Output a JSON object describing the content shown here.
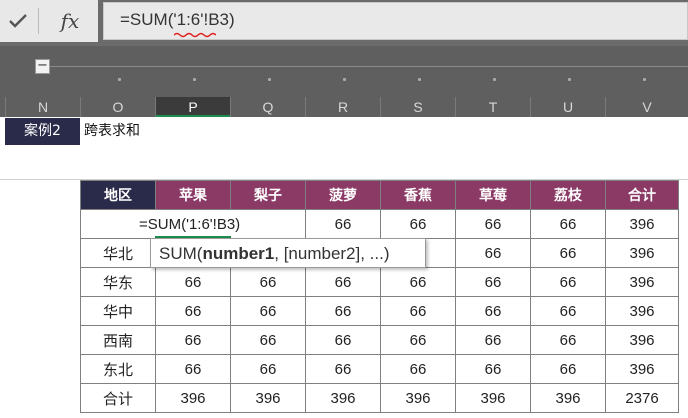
{
  "formula_bar": {
    "cancel_icon": "check-icon",
    "fx_label": "fx",
    "formula_text": "=SUM('1:6'!B3)"
  },
  "ribbon": {
    "collapse_label": "−"
  },
  "columns": [
    "N",
    "O",
    "P",
    "Q",
    "R",
    "S",
    "T",
    "U",
    "V"
  ],
  "active_column": "P",
  "sheet": {
    "case_label": "案例2",
    "case_title": "跨表求和"
  },
  "table": {
    "headers": [
      "地区",
      "苹果",
      "梨子",
      "菠萝",
      "香蕉",
      "草莓",
      "荔枝",
      "合计"
    ],
    "edit_cell_text": "=SUM('1:6'!B3)",
    "first_row_rest": [
      "66",
      "66",
      "66",
      "66",
      "396"
    ],
    "rows": [
      {
        "region": "华北",
        "values": [
          "",
          "",
          "",
          "66",
          "66",
          "66",
          "396"
        ]
      },
      {
        "region": "华东",
        "values": [
          "66",
          "66",
          "66",
          "66",
          "66",
          "66",
          "396"
        ]
      },
      {
        "region": "华中",
        "values": [
          "66",
          "66",
          "66",
          "66",
          "66",
          "66",
          "396"
        ]
      },
      {
        "region": "西南",
        "values": [
          "66",
          "66",
          "66",
          "66",
          "66",
          "66",
          "396"
        ]
      },
      {
        "region": "东北",
        "values": [
          "66",
          "66",
          "66",
          "66",
          "66",
          "66",
          "396"
        ]
      },
      {
        "region": "合计",
        "values": [
          "396",
          "396",
          "396",
          "396",
          "396",
          "396",
          "2376"
        ]
      }
    ]
  },
  "tooltip": {
    "prefix": "SUM(",
    "bold_arg": "number1",
    "suffix": ", [number2], ...)"
  },
  "colors": {
    "header_region": "#2a2b4a",
    "header_fruit": "#8b3a66",
    "selection": "#1e8c4e"
  }
}
